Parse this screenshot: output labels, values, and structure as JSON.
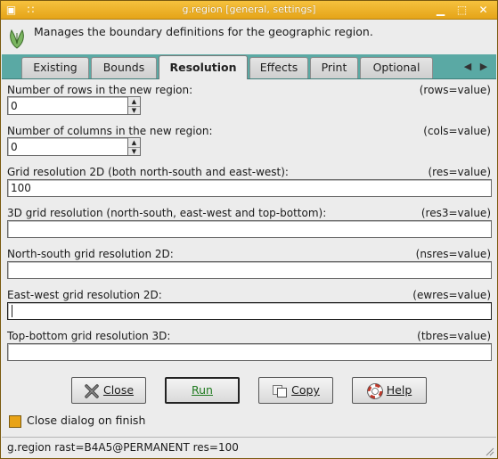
{
  "window": {
    "title": "g.region [general, settings]",
    "menu_glyph": "▣",
    "pin_glyph": "∷",
    "minimize_glyph": "▁",
    "maximize_glyph": "⬚",
    "close_glyph": "✕"
  },
  "header": {
    "description": "Manages the boundary definitions for the geographic region.",
    "icon": "grass-leaf-icon"
  },
  "tabs": [
    {
      "label": "Existing"
    },
    {
      "label": "Bounds"
    },
    {
      "label": "Resolution",
      "active": true
    },
    {
      "label": "Effects"
    },
    {
      "label": "Print"
    },
    {
      "label": "Optional"
    }
  ],
  "tab_scroll": {
    "left": "◀",
    "right": "▶"
  },
  "fields": {
    "rows": {
      "label": "Number of rows in the new region:",
      "key": "(rows=value)",
      "value": "0"
    },
    "cols": {
      "label": "Number of columns in the new region:",
      "key": "(cols=value)",
      "value": "0"
    },
    "res": {
      "label": "Grid resolution 2D (both north-south and east-west):",
      "key": "(res=value)",
      "value": "100"
    },
    "res3": {
      "label": "3D grid resolution (north-south, east-west and top-bottom):",
      "key": "(res3=value)",
      "value": ""
    },
    "nsres": {
      "label": "North-south grid resolution 2D:",
      "key": "(nsres=value)",
      "value": ""
    },
    "ewres": {
      "label": "East-west grid resolution 2D:",
      "key": "(ewres=value)",
      "value": ""
    },
    "tbres": {
      "label": "Top-bottom grid resolution 3D:",
      "key": "(tbres=value)",
      "value": ""
    }
  },
  "spin_arrows": {
    "up": "▲",
    "down": "▼"
  },
  "buttons": {
    "close": "Close",
    "run": "Run",
    "copy": "Copy",
    "help": "Help"
  },
  "options": {
    "close_on_finish_label": "Close dialog on finish",
    "close_on_finish_checked": false
  },
  "status": {
    "command": "g.region rast=B4A5@PERMANENT res=100"
  },
  "colors": {
    "titlebar": "#e5a418",
    "tabstrip": "#5aa9a4",
    "run_text": "#1f7a1f",
    "checkbox": "#e8a317"
  }
}
